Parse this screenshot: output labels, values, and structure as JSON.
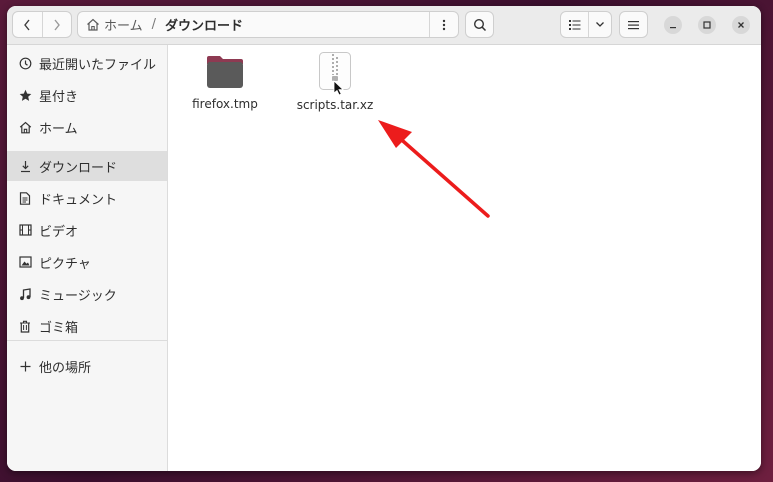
{
  "breadcrumb": {
    "home_label": "ホーム",
    "separator": "/",
    "current": "ダウンロード"
  },
  "sidebar": {
    "items": [
      {
        "label": "最近開いたファイル",
        "icon": "clock-icon"
      },
      {
        "label": "星付き",
        "icon": "star-icon"
      },
      {
        "label": "ホーム",
        "icon": "home-icon"
      },
      {
        "label": "ダウンロード",
        "icon": "download-icon",
        "active": true
      },
      {
        "label": "ドキュメント",
        "icon": "document-icon"
      },
      {
        "label": "ビデオ",
        "icon": "video-icon"
      },
      {
        "label": "ピクチャ",
        "icon": "picture-icon"
      },
      {
        "label": "ミュージック",
        "icon": "music-icon"
      },
      {
        "label": "ゴミ箱",
        "icon": "trash-icon"
      }
    ],
    "other_locations": {
      "label": "他の場所",
      "icon": "plus-icon"
    }
  },
  "files": [
    {
      "name": "firefox.tmp",
      "icon": "folder-icon"
    },
    {
      "name": "scripts.tar.xz",
      "icon": "archive-file-icon"
    }
  ],
  "colors": {
    "folder": "#5a5a5a",
    "folder_tab": "#8e3a52",
    "arrow": "#ec1c1c",
    "active_row": "#dedede"
  }
}
